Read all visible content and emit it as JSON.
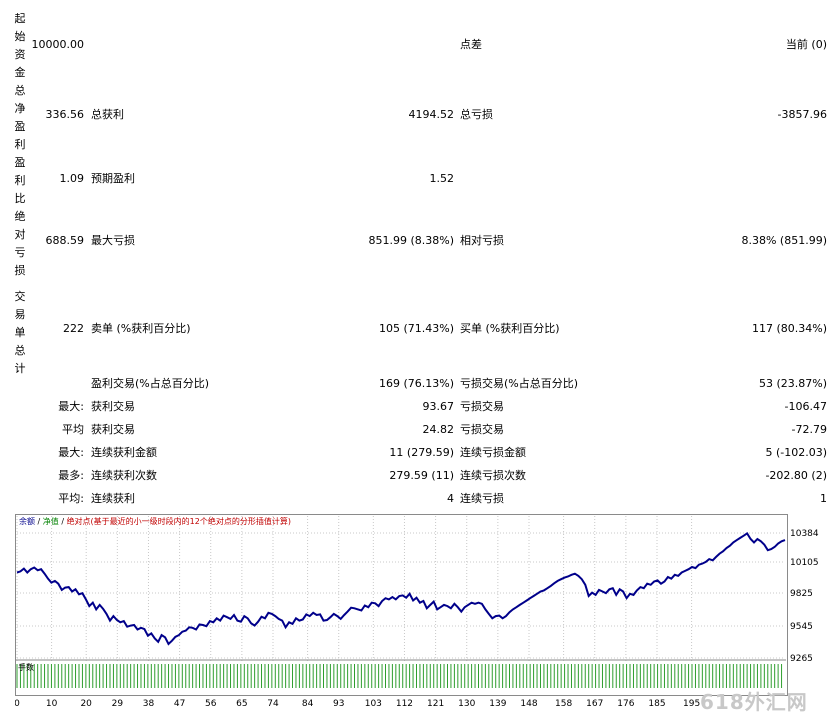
{
  "report": {
    "side_labels": [
      "起始资金",
      "总净盈利",
      "盈利比",
      "绝对亏损",
      "交易单总计"
    ],
    "rows": [
      {
        "v1": "10000.00",
        "l2": "",
        "v2": "",
        "l3": "点差",
        "v3": "当前 (0)"
      },
      {
        "v1": "336.56",
        "l2": "总获利",
        "v2": "4194.52",
        "l3": "总亏损",
        "v3": "-3857.96"
      },
      {
        "v1": "1.09",
        "l2": "预期盈利",
        "v2": "1.52",
        "l3": "",
        "v3": ""
      },
      {
        "v1": "688.59",
        "l2": "最大亏损",
        "v2": "851.99 (8.38%)",
        "l3": "相对亏损",
        "v3": "8.38% (851.99)"
      },
      {
        "v1": "222",
        "l2": "卖单 (%获利百分比)",
        "v2": "105 (71.43%)",
        "l3": "买单 (%获利百分比)",
        "v3": "117 (80.34%)"
      }
    ],
    "rows2": [
      {
        "p": "",
        "l2": "盈利交易(%占总百分比)",
        "v2": "169 (76.13%)",
        "l3": "亏损交易(%占总百分比)",
        "v3": "53 (23.87%)"
      },
      {
        "p": "最大:",
        "l2": "获利交易",
        "v2": "93.67",
        "l3": "亏损交易",
        "v3": "-106.47"
      },
      {
        "p": "平均",
        "l2": "获利交易",
        "v2": "24.82",
        "l3": "亏损交易",
        "v3": "-72.79"
      },
      {
        "p": "最大:",
        "l2": "连续获利金额",
        "v2": "11 (279.59)",
        "l3": "连续亏损金额",
        "v3": "5 (-102.03)"
      },
      {
        "p": "最多:",
        "l2": "连续获利次数",
        "v2": "279.59 (11)",
        "l3": "连续亏损次数",
        "v3": "-202.80 (2)"
      },
      {
        "p": "平均:",
        "l2": "连续获利",
        "v2": "4",
        "l3": "连续亏损",
        "v3": "1"
      }
    ]
  },
  "chart": {
    "legend_balance": "余额",
    "legend_sep1": " / ",
    "legend_equity": "净值",
    "legend_sep2": " / ",
    "legend_rest": "绝对点(基于最近的小一级时段内的12个绝对点的分形插值计算)",
    "volume_label": "手数",
    "colors": {
      "line": "#00008b",
      "legend_red": "#c00000",
      "legend_green": "#008000",
      "volume": "#2e9e2e",
      "grid": "#c8c8c8"
    }
  },
  "chart_data": {
    "type": "line",
    "y_ticks": [
      "10384",
      "10105",
      "9825",
      "9545",
      "9265"
    ],
    "x_ticks": [
      "0",
      "10",
      "20",
      "29",
      "38",
      "47",
      "56",
      "65",
      "74",
      "84",
      "93",
      "103",
      "112",
      "121",
      "130",
      "139",
      "148",
      "158",
      "167",
      "176",
      "185",
      "195"
    ],
    "xlim": [
      0,
      222
    ],
    "ylim": [
      9265,
      10430
    ],
    "series": [
      {
        "values": [
          10030,
          10040,
          10065,
          10030,
          10060,
          10075,
          10050,
          10060,
          10020,
          9975,
          9940,
          9955,
          9930,
          9875,
          9895,
          9900,
          9860,
          9880,
          9835,
          9845,
          9790,
          9730,
          9760,
          9700,
          9740,
          9705,
          9660,
          9600,
          9640,
          9605,
          9585,
          9595,
          9545,
          9555,
          9560,
          9520,
          9535,
          9525,
          9465,
          9485,
          9440,
          9410,
          9470,
          9450,
          9390,
          9420,
          9455,
          9470,
          9500,
          9510,
          9540,
          9535,
          9520,
          9565,
          9560,
          9550,
          9595,
          9585,
          9620,
          9600,
          9645,
          9630,
          9615,
          9650,
          9600,
          9590,
          9640,
          9620,
          9575,
          9555,
          9590,
          9635,
          9620,
          9670,
          9660,
          9640,
          9615,
          9600,
          9540,
          9585,
          9570,
          9620,
          9600,
          9610,
          9655,
          9640,
          9670,
          9650,
          9655,
          9600,
          9605,
          9630,
          9660,
          9640,
          9615,
          9650,
          9680,
          9715,
          9710,
          9700,
          9690,
          9735,
          9720,
          9760,
          9755,
          9730,
          9775,
          9800,
          9790,
          9810,
          9790,
          9820,
          9825,
          9805,
          9840,
          9780,
          9805,
          9760,
          9775,
          9710,
          9740,
          9770,
          9700,
          9720,
          9740,
          9730,
          9710,
          9750,
          9720,
          9680,
          9720,
          9740,
          9760,
          9750,
          9760,
          9750,
          9700,
          9660,
          9620,
          9640,
          9645,
          9620,
          9640,
          9675,
          9700,
          9720,
          9740,
          9760,
          9780,
          9800,
          9820,
          9840,
          9860,
          9870,
          9890,
          9910,
          9935,
          9955,
          9970,
          9985,
          9995,
          10010,
          10020,
          10000,
          9970,
          9920,
          9820,
          9850,
          9830,
          9875,
          9860,
          9845,
          9880,
          9890,
          9830,
          9880,
          9860,
          9800,
          9840,
          9830,
          9870,
          9900,
          9890,
          9930,
          9920,
          9950,
          9960,
          9930,
          9950,
          9990,
          9975,
          10010,
          10000,
          10030,
          10045,
          10060,
          10080,
          10070,
          10100,
          10110,
          10125,
          10150,
          10140,
          10170,
          10200,
          10220,
          10250,
          10270,
          10300,
          10320,
          10340,
          10360,
          10380,
          10330,
          10300,
          10330,
          10310,
          10280,
          10230,
          10240,
          10260,
          10290,
          10310,
          10320
        ]
      }
    ]
  }
}
